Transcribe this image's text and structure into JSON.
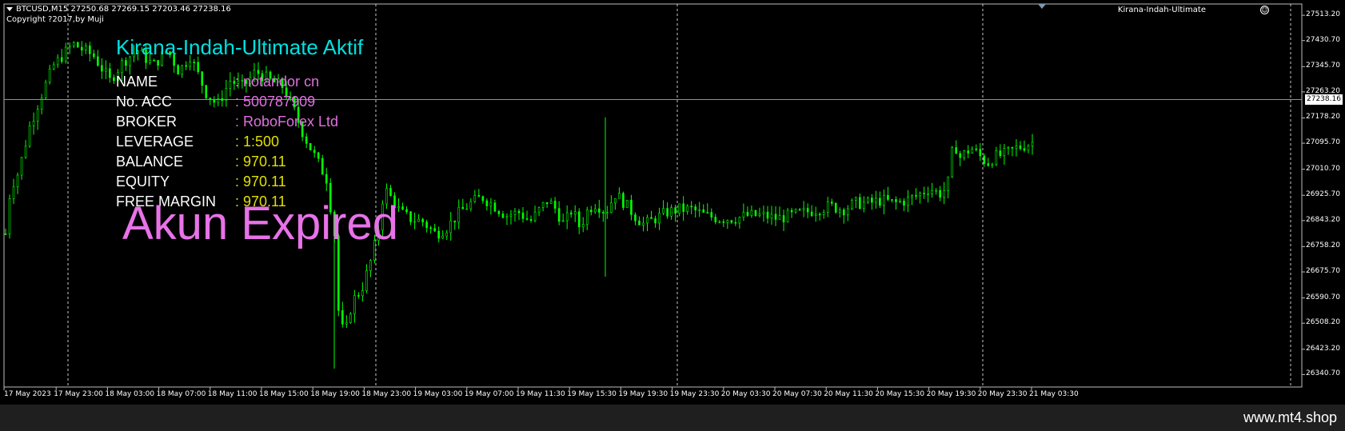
{
  "chart": {
    "symbol_header": "BTCUSD,M15  27250.68 27269.15 27203.46 27238.16",
    "copyright": "Copyright ?2017,by   Muji",
    "indicator_name": "Kirana-Indah-Ultimate",
    "current_price": "27238.16",
    "price_ticks": [
      "27513.20",
      "27430.70",
      "27345.70",
      "27263.20",
      "27178.20",
      "27095.70",
      "27010.70",
      "26925.70",
      "26843.20",
      "26758.20",
      "26675.70",
      "26590.70",
      "26508.20",
      "26423.20",
      "26340.70"
    ],
    "time_ticks": [
      "17 May 2023",
      "17 May 23:00",
      "18 May 03:00",
      "18 May 07:00",
      "18 May 11:00",
      "18 May 15:00",
      "18 May 19:00",
      "18 May 23:00",
      "19 May 03:00",
      "19 May 07:00",
      "19 May 11:30",
      "19 May 15:30",
      "19 May 19:30",
      "19 May 23:30",
      "20 May 03:30",
      "20 May 07:30",
      "20 May 11:30",
      "20 May 15:30",
      "20 May 19:30",
      "20 May 23:30",
      "21 May 03:30"
    ],
    "colors": {
      "candles": "#00ff00",
      "background": "#000000",
      "grid": "#c8c8c8",
      "price_line": "#7f96b4"
    },
    "price_path": [
      [
        0,
        26800
      ],
      [
        0.3,
        26950
      ],
      [
        0.8,
        27000
      ],
      [
        1.5,
        27150
      ],
      [
        2.2,
        27250
      ],
      [
        3,
        27350
      ],
      [
        4.2,
        27420
      ],
      [
        5.5,
        27380
      ],
      [
        6.5,
        27300
      ],
      [
        7.3,
        27360
      ],
      [
        8.2,
        27400
      ],
      [
        9.2,
        27350
      ],
      [
        10.1,
        27400
      ],
      [
        10.8,
        27330
      ],
      [
        11.5,
        27380
      ],
      [
        12.5,
        27260
      ],
      [
        13.2,
        27220
      ],
      [
        14,
        27300
      ],
      [
        14.8,
        27280
      ],
      [
        15.6,
        27330
      ],
      [
        16.5,
        27300
      ],
      [
        17.3,
        27280
      ],
      [
        18,
        27200
      ],
      [
        18.6,
        27120
      ],
      [
        19.3,
        27050
      ],
      [
        20,
        26980
      ],
      [
        20.5,
        26800
      ],
      [
        20.8,
        26500
      ],
      [
        21.2,
        26480
      ],
      [
        21.6,
        26580
      ],
      [
        22.2,
        26620
      ],
      [
        22.7,
        26700
      ],
      [
        23,
        26760
      ],
      [
        23.2,
        26800
      ],
      [
        23.6,
        26950
      ],
      [
        24,
        26920
      ],
      [
        24.6,
        26870
      ],
      [
        25.2,
        26850
      ],
      [
        26,
        26840
      ],
      [
        26.8,
        26800
      ],
      [
        27.5,
        26820
      ],
      [
        28.3,
        26870
      ],
      [
        29,
        26900
      ],
      [
        29.7,
        26920
      ],
      [
        30.5,
        26890
      ],
      [
        31.2,
        26860
      ],
      [
        32,
        26870
      ],
      [
        32.7,
        26840
      ],
      [
        33.3,
        26880
      ],
      [
        33.8,
        26910
      ],
      [
        34.3,
        26880
      ],
      [
        34.8,
        26830
      ],
      [
        35.3,
        26880
      ],
      [
        35.8,
        26820
      ],
      [
        36.3,
        26880
      ],
      [
        36.8,
        26900
      ],
      [
        37.4,
        26870
      ],
      [
        38,
        26930
      ],
      [
        38.6,
        26900
      ],
      [
        39.2,
        26860
      ],
      [
        39.8,
        26830
      ],
      [
        40.5,
        26850
      ],
      [
        41.2,
        26870
      ],
      [
        42,
        26880
      ],
      [
        42.8,
        26880
      ],
      [
        43.6,
        26860
      ],
      [
        44.5,
        26850
      ],
      [
        45.4,
        26850
      ],
      [
        46.3,
        26860
      ],
      [
        47.2,
        26860
      ],
      [
        48.1,
        26850
      ],
      [
        49,
        26860
      ],
      [
        49.8,
        26870
      ],
      [
        50.6,
        26880
      ],
      [
        51.4,
        26890
      ],
      [
        52.2,
        26880
      ],
      [
        53,
        26900
      ],
      [
        53.8,
        26900
      ],
      [
        54.6,
        26910
      ],
      [
        55.4,
        26900
      ],
      [
        56.2,
        26910
      ],
      [
        57,
        26930
      ],
      [
        57.6,
        26950
      ],
      [
        58.2,
        26930
      ],
      [
        58.7,
        26950
      ],
      [
        59.1,
        27100
      ],
      [
        59.5,
        27050
      ],
      [
        60.2,
        27080
      ],
      [
        60.8,
        27050
      ],
      [
        61.2,
        27030
      ],
      [
        61.6,
        27050
      ],
      [
        62.3,
        27060
      ],
      [
        63,
        27080
      ],
      [
        63.6,
        27090
      ],
      [
        64.1,
        27100
      ],
      [
        64.4,
        27180
      ],
      [
        64.6,
        27240
      ],
      [
        64.8,
        27238
      ]
    ],
    "price_range": [
      26300,
      27550
    ]
  },
  "overlay": {
    "title": "Kirana-Indah-Ultimate Aktif",
    "rows": [
      {
        "label": "NAME",
        "value": ": notandor cn",
        "color": "pink"
      },
      {
        "label": "No. ACC",
        "value": ": 500787909",
        "color": "pink"
      },
      {
        "label": "BROKER",
        "value": ": RoboForex Ltd",
        "color": "pink"
      },
      {
        "label": "LEVERAGE",
        "value": ": 1:500",
        "color": "yellow"
      },
      {
        "label": "BALANCE",
        "value": ": 970.11",
        "color": "yellow"
      },
      {
        "label": "EQUITY",
        "value": ": 970.11",
        "color": "yellow"
      },
      {
        "label": "FREE MARGIN",
        "value": ": 970.11",
        "color": "yellow"
      }
    ],
    "expired_text": "Akun Expired"
  },
  "footer": {
    "site": "www.mt4.shop"
  }
}
